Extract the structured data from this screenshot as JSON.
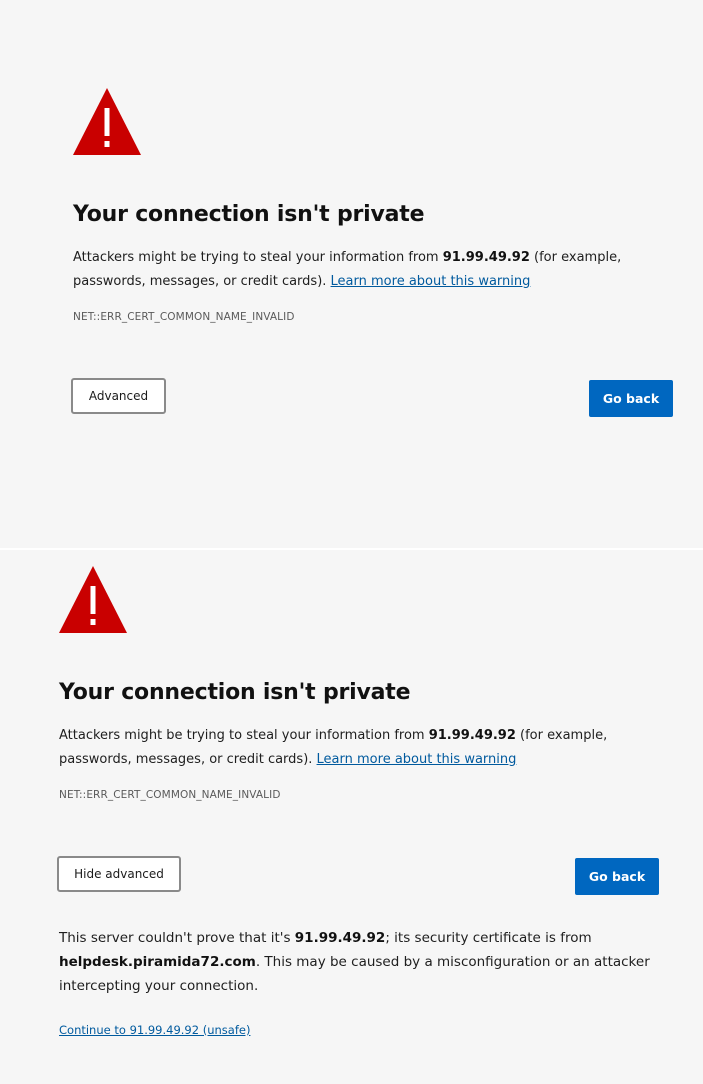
{
  "colors": {
    "background": "#f6f6f6",
    "warning_red": "#c90000",
    "link_blue": "#005a9e",
    "primary_button": "#0067c0"
  },
  "top_page": {
    "heading": "Your connection isn't private",
    "desc_part1": "Attackers might be trying to steal your information from ",
    "host": "91.99.49.92",
    "desc_part2": " (for example, passwords, messages, or credit cards). ",
    "learn_more": "Learn more about this warning",
    "error_code": "NET::ERR_CERT_COMMON_NAME_INVALID",
    "advanced_button": "Advanced",
    "go_back_button": "Go back",
    "icon": "warning-triangle-icon"
  },
  "bottom_page": {
    "heading": "Your connection isn't private",
    "desc_part1": "Attackers might be trying to steal your information from ",
    "host": "91.99.49.92",
    "desc_part2": " (for example, passwords, messages, or credit cards). ",
    "learn_more": "Learn more about this warning",
    "error_code": "NET::ERR_CERT_COMMON_NAME_INVALID",
    "hide_advanced_button": "Hide advanced",
    "go_back_button": "Go back",
    "icon": "warning-triangle-icon",
    "details_part1": "This server couldn't prove that it's ",
    "details_host": "91.99.49.92",
    "details_part2": "; its security certificate is from ",
    "details_cert_domain": "helpdesk.piramida72.com",
    "details_part3": ". This may be caused by a misconfiguration or an attacker intercepting your connection.",
    "continue_link": "Continue to 91.99.49.92 (unsafe)"
  }
}
